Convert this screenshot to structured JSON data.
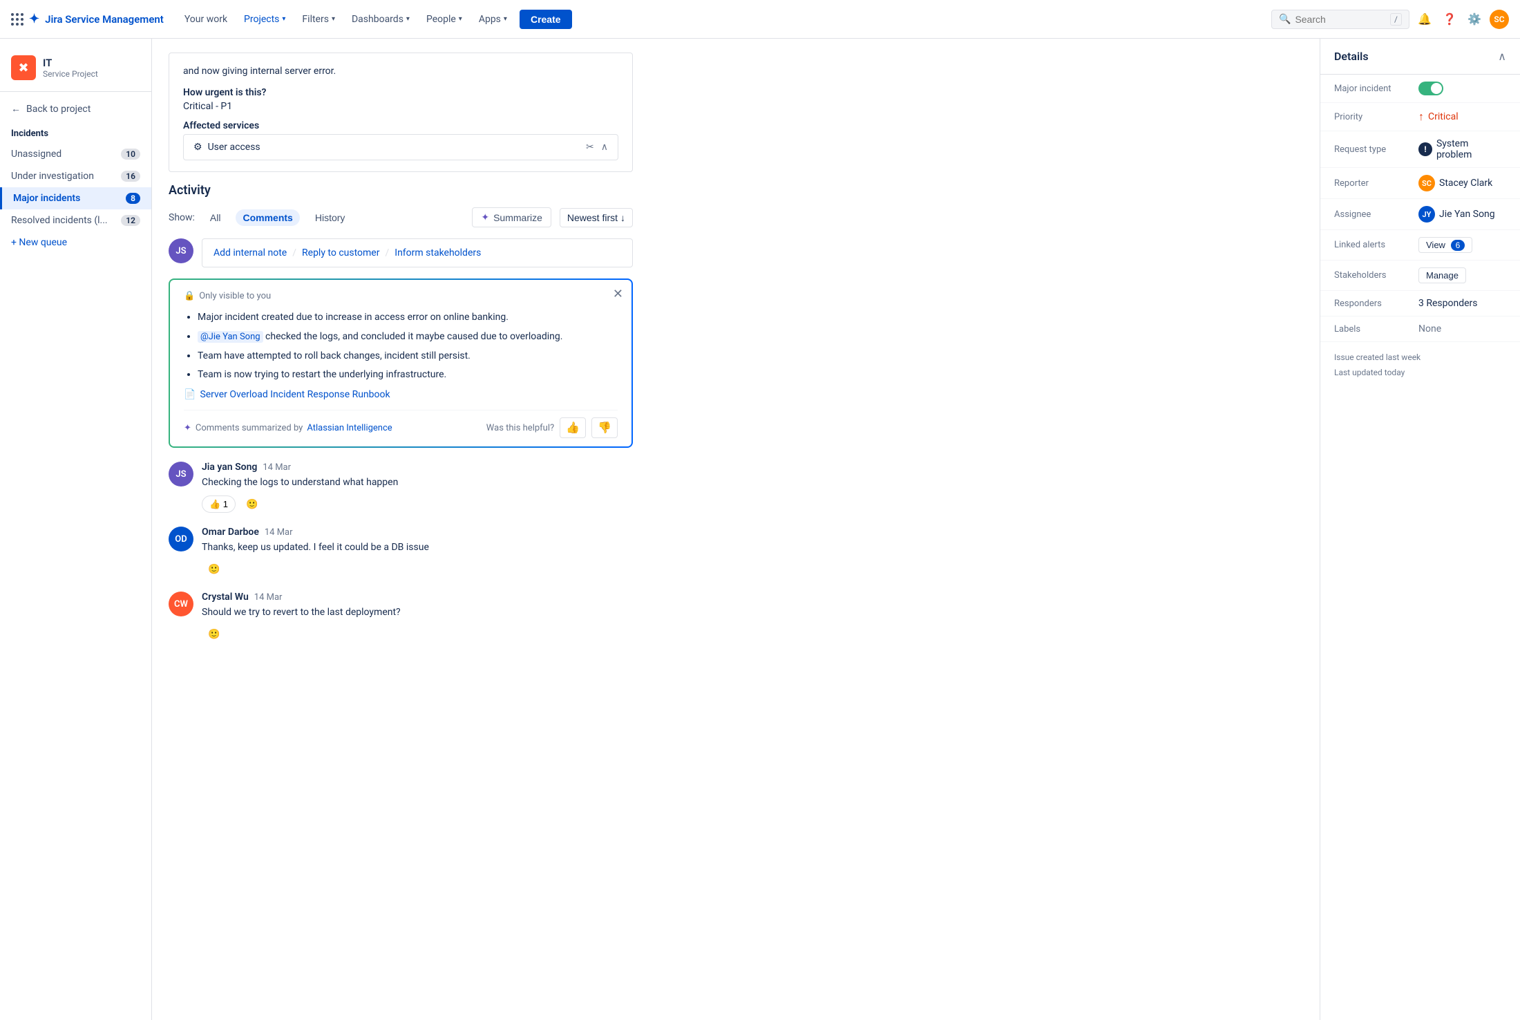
{
  "topnav": {
    "logo_text": "Jira Service Management",
    "nav_items": [
      {
        "label": "Your work",
        "has_chevron": false
      },
      {
        "label": "Projects",
        "has_chevron": true
      },
      {
        "label": "Filters",
        "has_chevron": true
      },
      {
        "label": "Dashboards",
        "has_chevron": true
      },
      {
        "label": "People",
        "has_chevron": true
      },
      {
        "label": "Apps",
        "has_chevron": true
      }
    ],
    "create_label": "Create",
    "search_placeholder": "Search",
    "search_shortcut": "/"
  },
  "sidebar": {
    "project_name": "IT",
    "project_type": "Service Project",
    "back_label": "Back to project",
    "section_title": "Incidents",
    "items": [
      {
        "label": "Unassigned",
        "count": "10",
        "active": false
      },
      {
        "label": "Under investigation",
        "count": "16",
        "active": false
      },
      {
        "label": "Major incidents",
        "count": "8",
        "active": true
      },
      {
        "label": "Resolved incidents (l...",
        "count": "12",
        "active": false
      }
    ],
    "new_queue_label": "+ New queue"
  },
  "main": {
    "description_text": "and now giving internal server error.",
    "urgency_label": "How urgent is this?",
    "urgency_value": "Critical - P1",
    "affected_label": "Affected services",
    "service_name": "User access"
  },
  "activity": {
    "title": "Activity",
    "show_label": "Show:",
    "filters": [
      "All",
      "Comments",
      "History"
    ],
    "active_filter": "Comments",
    "summarize_label": "Summarize",
    "newest_label": "Newest first",
    "add_note_label": "Add internal note",
    "reply_label": "Reply to customer",
    "inform_label": "Inform stakeholders"
  },
  "summary_box": {
    "visibility_label": "Only visible to you",
    "bullets": [
      "Major incident created due to increase in access error on online banking.",
      " checked the logs, and concluded it maybe caused due to overloading.",
      "Team have attempted to roll back changes, incident still persist.",
      "Team is now trying to restart the underlying infrastructure."
    ],
    "mention_text": "@Jie Yan Song",
    "runbook_label": "Server Overload Incident Response Runbook",
    "ai_credit": "Comments summarized by ",
    "ai_link": "Atlassian Intelligence",
    "helpful_label": "Was this helpful?"
  },
  "comments": [
    {
      "author": "Jia yan Song",
      "date": "14 Mar",
      "text": "Checking the logs to understand what happen",
      "avatar_color": "#6554c0",
      "avatar_initials": "JS",
      "reactions": [
        {
          "emoji": "👍",
          "count": "1"
        }
      ]
    },
    {
      "author": "Omar Darboe",
      "date": "14 Mar",
      "text": "Thanks, keep us updated. I feel it could be a DB issue",
      "avatar_color": "#0052cc",
      "avatar_initials": "OD",
      "reactions": []
    },
    {
      "author": "Crystal Wu",
      "date": "14 Mar",
      "text": "Should we try to revert to the last deployment?",
      "avatar_color": "#ff5630",
      "avatar_initials": "CW",
      "reactions": []
    }
  ],
  "details": {
    "title": "Details",
    "rows": [
      {
        "label": "Major incident",
        "type": "toggle",
        "value": "on"
      },
      {
        "label": "Priority",
        "type": "priority",
        "value": "Critical"
      },
      {
        "label": "Request type",
        "type": "request",
        "value": "System problem"
      },
      {
        "label": "Reporter",
        "type": "avatar",
        "value": "Stacey Clark",
        "initials": "SC",
        "color": "#ff8b00"
      },
      {
        "label": "Assignee",
        "type": "avatar",
        "value": "Jie Yan Song",
        "initials": "JY",
        "color": "#0052cc"
      },
      {
        "label": "Linked alerts",
        "type": "badge",
        "value": "View",
        "badge": "6"
      },
      {
        "label": "Stakeholders",
        "type": "manage",
        "value": "Manage"
      },
      {
        "label": "Responders",
        "type": "text",
        "value": "3 Responders"
      },
      {
        "label": "Labels",
        "type": "text",
        "value": "None"
      }
    ],
    "created": "Issue created last week",
    "updated": "Last updated today"
  }
}
